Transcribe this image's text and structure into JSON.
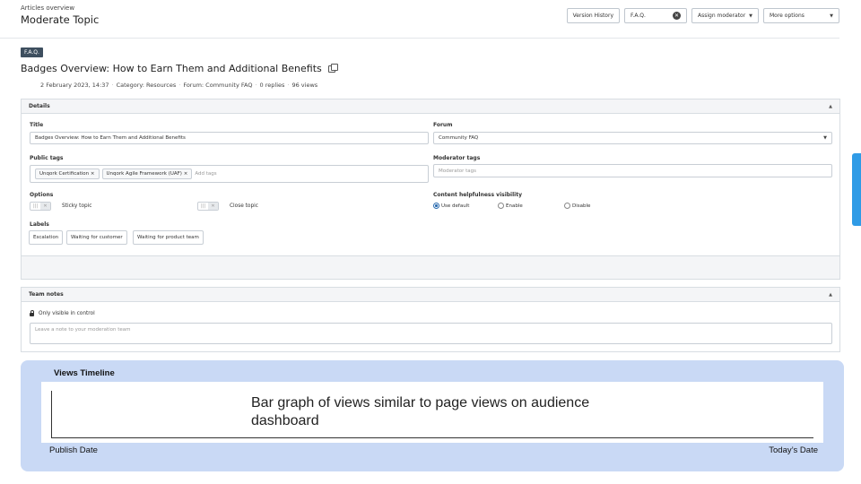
{
  "header": {
    "breadcrumb": "Articles overview",
    "title": "Moderate Topic",
    "version_history": "Version History",
    "category_value": "F.A.Q.",
    "assign_moderator": "Assign moderator",
    "more_options": "More options"
  },
  "topic": {
    "badge": "F.A.Q.",
    "title": "Badges Overview: How to Earn Them and Additional Benefits",
    "meta": [
      "2 February 2023, 14:37",
      "Category: Resources",
      "Forum: Community FAQ",
      "0 replies",
      "96 views"
    ]
  },
  "details": {
    "heading": "Details",
    "title_label": "Title",
    "title_value": "Badges Overview: How to Earn Them and Additional Benefits",
    "forum_label": "Forum",
    "forum_value": "Community FAQ",
    "public_tags_label": "Public tags",
    "public_tags": [
      "Unqork Certification",
      "Unqork Agile Framework (UAF)"
    ],
    "add_tags_placeholder": "Add tags",
    "moderator_tags_label": "Moderator tags",
    "moderator_tags_placeholder": "Moderator tags",
    "options_label": "Options",
    "sticky_topic": "Sticky topic",
    "close_topic": "Close topic",
    "helpfulness_label": "Content helpfulness visibility",
    "helpfulness_options": [
      "Use default",
      "Enable",
      "Disable"
    ],
    "helpfulness_selected": "Use default",
    "labels_label": "Labels",
    "labels": [
      "Escalation",
      "Waiting for customer",
      "Waiting for product team"
    ]
  },
  "team_notes": {
    "heading": "Team notes",
    "visibility": "Only visible in control",
    "placeholder": "Leave a note to your moderation team"
  },
  "timeline": {
    "title": "Views Timeline",
    "message": "Bar graph of views similar to page views on audience dashboard",
    "start_label": "Publish  Date",
    "end_label": "Today’s Date"
  }
}
